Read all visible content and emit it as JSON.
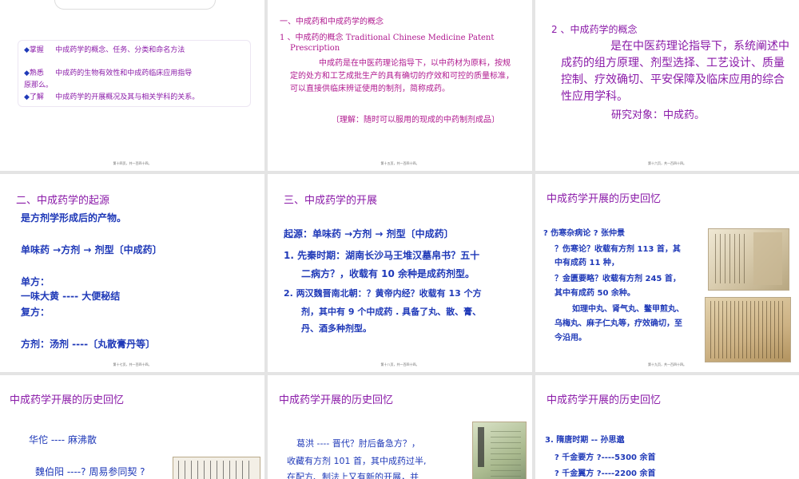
{
  "slides": {
    "s1": {
      "items": [
        {
          "bullet": "◆",
          "label": "掌握",
          "text": "中成药学的概念、任务、分类和命名方法"
        },
        {
          "bullet": "◆",
          "label": "熟悉",
          "text": "中成药的生物有效性和中成药临床应用指导"
        },
        {
          "text": "原那么。"
        },
        {
          "bullet": "◆",
          "label": "了解",
          "text": "中成药学的开展概况及其与相关学科的关系。"
        }
      ],
      "footer": "第十四页，共一百四十四。"
    },
    "s2": {
      "heading": "一、中成药和中成药学的概念",
      "sub1": "1 、中成药的概念 Traditional Chinese Medicine Patent",
      "sub2": "Prescription",
      "body": "中成药是在中医药理论指导下，以中药材为原料，按规定的处方和工艺成批生产的具有确切的疗效和可控的质量标准，可以直接供临床辨证使用的制剂，简称成药。",
      "note": "〔理解：随时可以服用的现成的中药制剂成品〕",
      "footer": "第十五页，共一百四十四。"
    },
    "s3": {
      "heading": "2 、中成药学的概念",
      "body": "是在中医药理论指导下，系统阐述中成药的组方原理、剂型选择、工艺设计、质量控制、疗效确切、平安保障及临床应用的综合性应用学科。",
      "object": "研究对象：中成药。",
      "footer": "第十六页，共一百四十四。"
    },
    "s4": {
      "heading": "二、中成药学的起源",
      "l1": "是方剂学形成后的产物。",
      "l2": "单味药 →方剂 → 剂型〔中成药〕",
      "l3": "单方：",
      "l4": "一味大黄 ---- 大便秘结",
      "l5": "复方：",
      "l6": "方剂：汤剂 ----〔丸散膏丹等〕",
      "footer": "第十七页，共一百四十四。"
    },
    "s5": {
      "heading": "三、中成药学的开展",
      "l1": "起源：单味药 →方剂 → 剂型〔中成药〕",
      "l2a": "1. 先秦时期：湖南长沙马王堆汉墓帛书？五十",
      "l2b": "二病方？，收载有 10 余种是成药剂型。",
      "l3a": "2. 两汉魏晋南北朝：？黄帝内经？收载有 13 个方",
      "l3b": "剂，其中有 9 个中成药 . 具备了丸、散、膏、",
      "l3c": "丹、酒多种剂型。",
      "footer": "第十八页，共一百四十四。"
    },
    "s6": {
      "heading": "中成药学开展的历史回忆",
      "l1": "? 伤寒杂病论 ? 张仲景",
      "l2a": "？伤寒论？收载有方剂 113 首，其",
      "l2b": "中有成药 11 种，",
      "l3a": "？金匮要略？收载有方剂 245 首，",
      "l3b": "其中有成药 50 余种。",
      "l4a": "如理中丸、肾气丸、鳖甲煎丸、",
      "l4b": "乌梅丸、麻子仁丸等，疗效确切，至",
      "l4c": "今沿用。",
      "footer": "第十九页，共一百四十四。"
    },
    "s7": {
      "heading": "中成药学开展的历史回忆",
      "l1": "华佗 ---- 麻沸散",
      "l2": "魏伯阳 ----? 周易参同契 ?"
    },
    "s8": {
      "heading": "中成药学开展的历史回忆",
      "l1": "葛洪 ---- 晋代？肘后备急方？，",
      "l2": "收藏有方剂 101 首，其中成药过半,",
      "l3": "在配方、制法上又有新的开展，并"
    },
    "s9": {
      "heading": "中成药学开展的历史回忆",
      "l1": "3. 隋唐时期 -- 孙思邈",
      "l2": "? 千金要方 ?----5300 余首",
      "l3": "? 千金翼方 ?----2200 余首"
    }
  },
  "colors": {
    "page_bg": "#e4e4e4",
    "slide_bg": "#ffffff",
    "blue_text": "#1f39b8",
    "purple_text": "#8a1aa8",
    "magenta_text": "#b0198f"
  }
}
